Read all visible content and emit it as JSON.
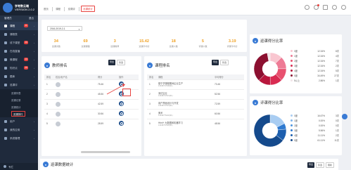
{
  "app": {
    "name": "学考数云端",
    "version": "VERSION 2.0.2",
    "admin_label": "管理员",
    "admin_action": "退出"
  },
  "sidebar": {
    "items": [
      {
        "label": "课程",
        "badge": "11",
        "top": true
      },
      {
        "label": "课程表",
        "badge": ""
      },
      {
        "label": "线下课堂",
        "badge": "10"
      },
      {
        "label": "在线直播",
        "badge": ""
      },
      {
        "label": "微课程",
        "badge": "13"
      },
      {
        "label": "知识点",
        "badge": "10"
      },
      {
        "label": "题库",
        "badge": ""
      },
      {
        "label": "巡课评",
        "badge": ""
      }
    ],
    "sub_items": [
      "巡课列表",
      "巡课记录",
      "巡课统计",
      "巡课排行"
    ],
    "sub_active": 3,
    "after_items": [
      "用户",
      "我的应用",
      "系统管理"
    ],
    "copyright": "专栏"
  },
  "breadcrumbs": [
    "首页",
    "课程",
    "巡课评",
    "巡课统计"
  ],
  "date_range": "2016-2019-2-1",
  "stats": [
    {
      "num": "34",
      "label": "巡课次数"
    },
    {
      "num": "69",
      "label": "巡课课程"
    },
    {
      "num": "3",
      "label": "巡课教师"
    },
    {
      "num": "15.42",
      "label": "巡课平均分"
    },
    {
      "num": "18",
      "label": "巡课人数"
    },
    {
      "num": "5",
      "label": "评课人数"
    },
    {
      "num": "3.19",
      "label": "评课平均分"
    }
  ],
  "teacher_rank": {
    "title": "教师排名",
    "btn_export": "导出",
    "btn_filter": "筛选",
    "columns": [
      "排名",
      "姓名/用户名",
      "得分",
      "操作"
    ],
    "rows": [
      {
        "rank": "1",
        "name": "",
        "score": "75.46"
      },
      {
        "rank": "2",
        "name": "",
        "score": "45.56"
      },
      {
        "rank": "3",
        "name": "",
        "score": "42.59"
      },
      {
        "rank": "4",
        "name": "",
        "score": "30.56"
      },
      {
        "rank": "5",
        "name": "",
        "score": "28.59"
      }
    ]
  },
  "course_rank": {
    "title": "课程排名",
    "btn_export": "导出",
    "btn_filter": "筛选",
    "columns": [
      "排名",
      "课程",
      "平均得分"
    ],
    "rows": [
      {
        "rank": "1",
        "course": "基于学课程期间企业生产",
        "code": "13018717048(01)",
        "score": "73.46"
      },
      {
        "rank": "2",
        "course": "测试企业",
        "code": "13018717021(01)",
        "score": "52.56"
      },
      {
        "rank": "3",
        "course": "用户界面设计与开发",
        "code": "13018717021(01)",
        "score": "72.59"
      },
      {
        "rank": "4",
        "course": "美术",
        "code": "13018775432(01)",
        "score": "60.56"
      },
      {
        "rank": "5",
        "course": "Html+ 大数据和机器学习",
        "code": "13018717020(01)",
        "score": "48.56"
      }
    ]
  },
  "patrol_pie": {
    "title": "巡课得分比率",
    "legend": [
      {
        "name": "0度",
        "pct": "12.34%",
        "count": "8次",
        "color": "#f9c6d0"
      },
      {
        "name": "1度",
        "pct": "12.34%",
        "count": "4次",
        "color": "#ee7b95"
      },
      {
        "name": "2度",
        "pct": "12.34%",
        "count": "7次",
        "color": "#e8516f"
      },
      {
        "name": "3度",
        "pct": "12.34%",
        "count": "2次",
        "color": "#d92c52"
      },
      {
        "name": "4度",
        "pct": "12.34%",
        "count": "5次",
        "color": "#b8173c"
      },
      {
        "name": "5度",
        "pct": "34.49%",
        "count": "27次",
        "color": "#8c1030"
      },
      {
        "name": "5以上",
        "pct": "2.86%",
        "count": "1次",
        "color": "#f2e4e8"
      }
    ]
  },
  "review_pie": {
    "title": "评课得分比率",
    "legend": [
      {
        "name": "0度",
        "pct": "16.67%",
        "count": "3次",
        "color": "#a9cdf2"
      },
      {
        "name": "1度",
        "pct": "0.00%",
        "count": "0次",
        "color": "#7eb3ea"
      },
      {
        "name": "2度",
        "pct": "0.00%",
        "count": "0次",
        "color": "#4d95df"
      },
      {
        "name": "3度",
        "pct": "5.56%",
        "count": "1次",
        "color": "#2f7ad0"
      },
      {
        "name": "4度",
        "pct": "11.11%",
        "count": "2次",
        "color": "#1d5fae"
      },
      {
        "name": "5度",
        "pct": "61.11%",
        "count": "11次",
        "color": "#154a8c"
      }
    ]
  },
  "bottom": {
    "title": "巡课数据统计",
    "btn1": "导出",
    "btn2": "筛选",
    "btn3": "刷新"
  }
}
